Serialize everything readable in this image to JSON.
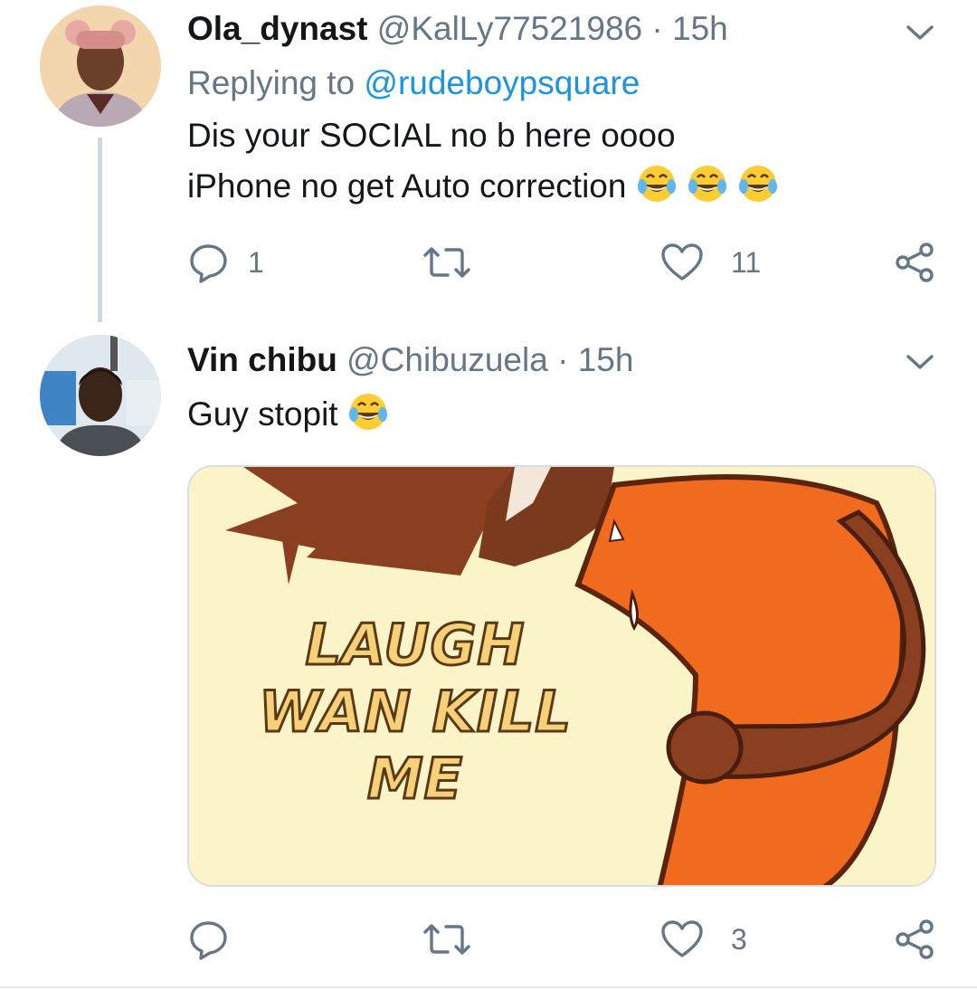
{
  "tweets": [
    {
      "display_name": "Ola_dynast",
      "handle": "@KalLy77521986",
      "separator": "·",
      "time": "15h",
      "replying_prefix": "Replying to",
      "replying_to": "@rudeboypsquare",
      "text_line1": "Dis your SOCIAL no b here oooo",
      "text_line2": "iPhone no get Auto correction",
      "text_line2_emoji": "face-with-tears-of-joy x3",
      "replies": "1",
      "retweets": "",
      "likes": "11"
    },
    {
      "display_name": "Vin chibu",
      "handle": "@Chibuzuela",
      "separator": "·",
      "time": "15h",
      "text_line1": "Guy stopit",
      "text_line1_emoji": "face-with-tears-of-joy",
      "media": {
        "meme_text_line1": "LAUGH",
        "meme_text_line2": "WAN KILL",
        "meme_text_line3": "ME"
      },
      "replies": "",
      "retweets": "",
      "likes": "3"
    }
  ],
  "icons": {
    "reply": "reply-icon",
    "retweet": "retweet-icon",
    "like": "heart-icon",
    "share": "share-icon",
    "menu": "chevron-down-icon"
  },
  "colors": {
    "text": "#14171a",
    "secondary": "#657786",
    "link": "#1b95e0",
    "thread_line": "#cfd9de"
  }
}
